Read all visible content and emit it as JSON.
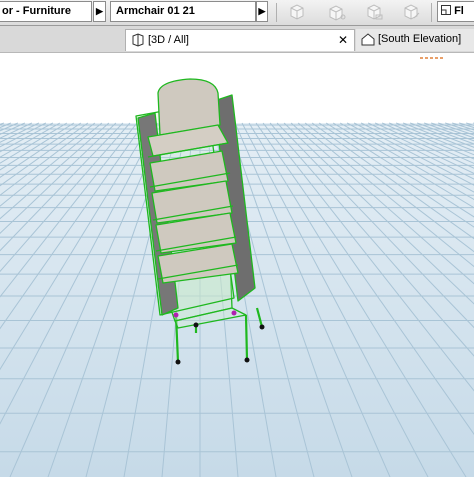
{
  "toolbar": {
    "layer": "or - Furniture",
    "element": "Armchair 01 21",
    "right_label": "Fl",
    "icons": [
      "view-3d-icon-1",
      "view-3d-icon-2",
      "view-3d-icon-3",
      "view-3d-icon-4"
    ]
  },
  "tabs": [
    {
      "label": "[3D / All]",
      "close": "✕",
      "active": true,
      "icon": "3d-cube-icon"
    },
    {
      "label": "[South Elevation]",
      "active": false,
      "icon": "house-elevation-icon"
    }
  ],
  "viewport": {
    "background_top": "#ffffff",
    "floor_color": "#cde0ec",
    "grid_color": "#a9c4d6",
    "selection_color": "#2fcf2f",
    "chair_fill": "#c9c2b6",
    "side_fill": "#7a7a7a"
  }
}
